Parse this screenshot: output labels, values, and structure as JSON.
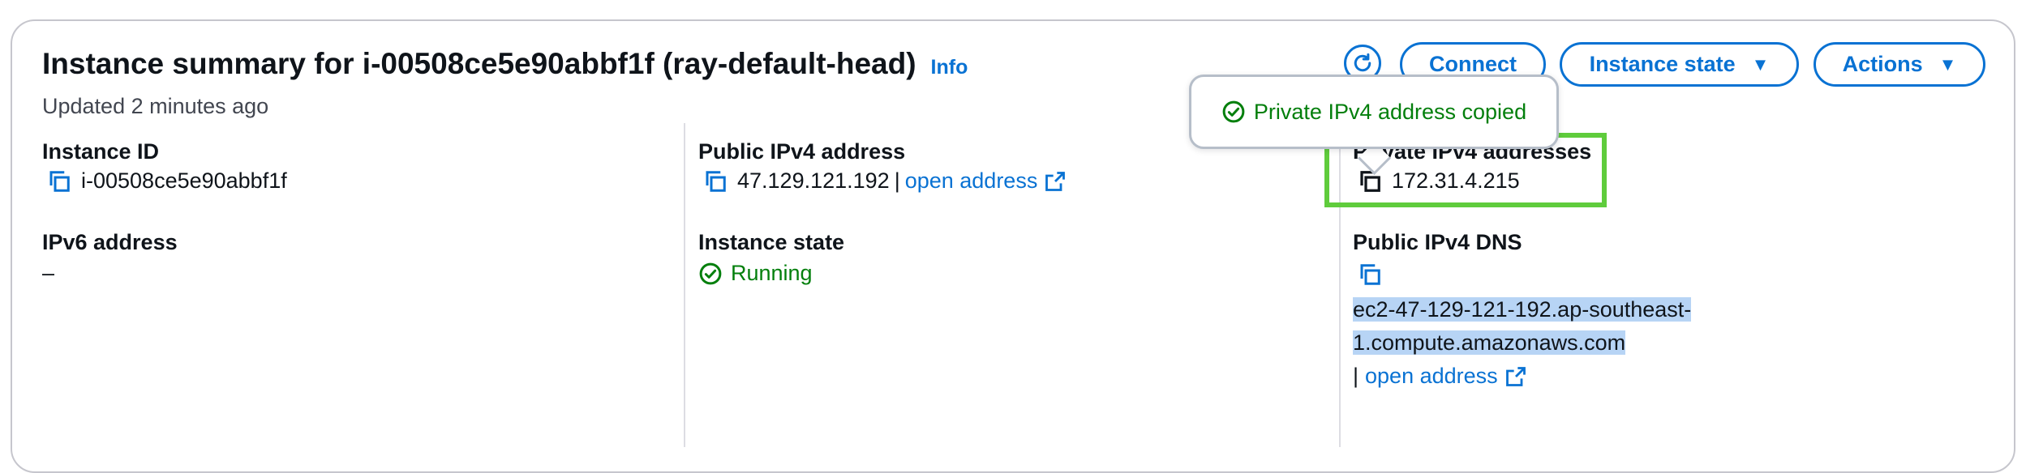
{
  "header": {
    "title": "Instance summary for i-00508ce5e90abbf1f (ray-default-head)",
    "info_label": "Info",
    "updated": "Updated 2 minutes ago"
  },
  "toolbar": {
    "refresh_icon": "refresh-icon",
    "connect_label": "Connect",
    "instance_state_label": "Instance state",
    "actions_label": "Actions"
  },
  "popover": {
    "message": "Private IPv4 address copied"
  },
  "fields": {
    "instance_id": {
      "label": "Instance ID",
      "value": "i-00508ce5e90abbf1f"
    },
    "public_ipv4": {
      "label": "Public IPv4 address",
      "value": "47.129.121.192",
      "separator": "|",
      "link": "open address"
    },
    "private_ipv4": {
      "label": "Private IPv4 addresses",
      "value": "172.31.4.215"
    },
    "ipv6": {
      "label": "IPv6 address",
      "value": "–"
    },
    "instance_state": {
      "label": "Instance state",
      "value": "Running"
    },
    "public_dns": {
      "label": "Public IPv4 DNS",
      "value_line1": "ec2-47-129-121-192.ap-southeast-",
      "value_line2": "1.compute.amazonaws.com",
      "separator": "|",
      "link": "open address"
    }
  },
  "colors": {
    "accent": "#0972d3",
    "success": "#037f0c",
    "highlight_box": "#5fcc3c",
    "selection": "#b7d4f5"
  }
}
